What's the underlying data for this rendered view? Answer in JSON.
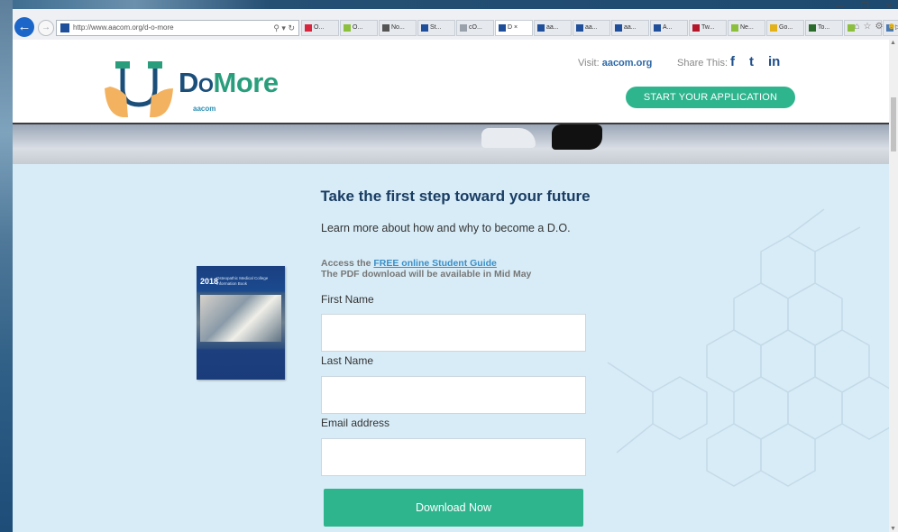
{
  "browser": {
    "url": "http://www.aacom.org/d-o-more",
    "tabs": [
      {
        "label": "O...",
        "color": "#d7263d"
      },
      {
        "label": "O...",
        "color": "#8bbf3c"
      },
      {
        "label": "No...",
        "color": "#555555"
      },
      {
        "label": "St...",
        "color": "#1f4f9a"
      },
      {
        "label": "cO...",
        "color": "#9aa1aa"
      },
      {
        "label": "D ×",
        "color": "#1f4f9a",
        "active": true
      },
      {
        "label": "aa...",
        "color": "#1f4f9a"
      },
      {
        "label": "aa...",
        "color": "#1f4f9a"
      },
      {
        "label": "aa...",
        "color": "#1f4f9a"
      },
      {
        "label": "A...",
        "color": "#1f4f9a"
      },
      {
        "label": "Tw...",
        "color": "#b5162a"
      },
      {
        "label": "Ne...",
        "color": "#8bbf3c"
      },
      {
        "label": "Go...",
        "color": "#e3b21b"
      },
      {
        "label": "To...",
        "color": "#2a6a2a"
      },
      {
        "label": "",
        "color": "#8bbf3c"
      },
      {
        "label": "▷ ...",
        "color": "#4a7ab5"
      }
    ]
  },
  "header": {
    "logo_d": "D",
    "logo_o": "O",
    "logo_more": "More",
    "logo_sub": "aacom",
    "visit_prefix": "Visit:",
    "visit_link": "aacom.org",
    "share_label": "Share This:",
    "social": [
      "f",
      "t",
      "in"
    ],
    "apply_button": "START YOUR APPLICATION"
  },
  "main": {
    "title": "Take the first step toward your future",
    "subtitle": "Learn more about how and why to become a D.O.",
    "book": {
      "year": "2018",
      "title": "Osteopathic Medical College Information Book"
    },
    "access_prefix": "Access the",
    "access_link": "FREE online Student Guide",
    "access_note": "The PDF download will be available in Mid May",
    "fields": [
      {
        "label": "First Name",
        "value": ""
      },
      {
        "label": "Last Name",
        "value": ""
      },
      {
        "label": "Email address",
        "value": ""
      }
    ],
    "download_button": "Download Now"
  },
  "colors": {
    "accent": "#2fb58e",
    "navy": "#1a3d63",
    "page_bg": "#d8ecf7"
  }
}
